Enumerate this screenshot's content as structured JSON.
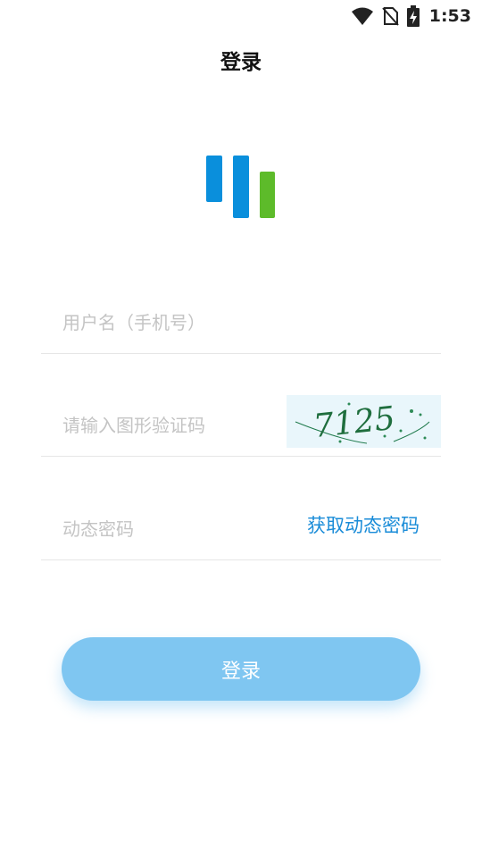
{
  "status_bar": {
    "time": "1:53",
    "icons": [
      "wifi-icon",
      "no-sim-icon",
      "battery-charging-icon"
    ]
  },
  "header": {
    "title": "登录"
  },
  "logo": {
    "colors": [
      "#0a8fdc",
      "#0a8fdc",
      "#5dbb2a"
    ]
  },
  "form": {
    "username": {
      "value": "",
      "placeholder": "用户名（手机号）"
    },
    "captcha": {
      "value": "",
      "placeholder": "请输入图形验证码",
      "image_text": "7125"
    },
    "otp": {
      "value": "",
      "placeholder": "动态密码",
      "get_code_label": "获取动态密码"
    },
    "submit_label": "登录"
  },
  "colors": {
    "accent": "#1a8cd8",
    "button": "#7fc6f1",
    "logo_blue": "#0a8fdc",
    "logo_green": "#5dbb2a"
  }
}
